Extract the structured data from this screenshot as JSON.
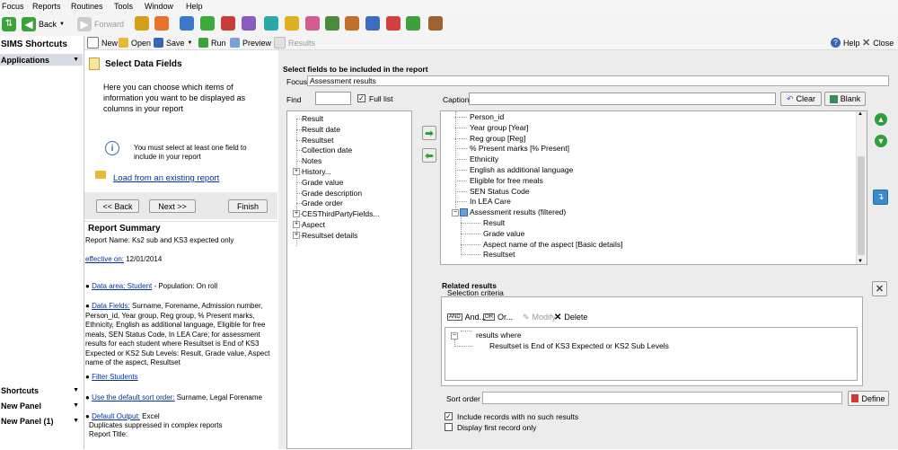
{
  "menu": [
    "Focus",
    "Reports",
    "Routines",
    "Tools",
    "Window",
    "Help"
  ],
  "toolbar": {
    "back": "Back",
    "forward": "Forward"
  },
  "sidebar": {
    "title": "SIMS Shortcuts",
    "applications": "Applications",
    "shortcuts": "Shortcuts",
    "new_panel": "New Panel",
    "new_panel_1": "New Panel (1)"
  },
  "report_toolbar": {
    "new": "New",
    "open": "Open",
    "save": "Save",
    "run": "Run",
    "preview": "Preview",
    "results": "Results",
    "help": "Help",
    "close": "Close"
  },
  "wizard": {
    "title": "Select Data Fields",
    "description": "Here you can choose which items of information you want to be displayed as columns in your report",
    "info": "You must select at least one field to include in your report",
    "load_link": "Load from an existing report",
    "back": "<< Back",
    "next": "Next >>",
    "finish": "Finish"
  },
  "summary": {
    "title": "Report Summary",
    "report_name": "Report Name:  Ks2 sub and KS3 expected only",
    "effective_link": "effective on:",
    "effective_date": " 12/01/2014",
    "data_area_link": "Data area: Student",
    "data_area_text": " - Population: On roll",
    "data_fields_link": "Data Fields:",
    "data_fields_text": " Surname, Forename, Admission number, Person_id, Year group, Reg group, % Present marks, Ethnicity, English as additional language, Eligible for free meals, SEN Status Code, In LEA Care; for assessment results for each student where Resultset is End of KS3 Expected or KS2 Sub Levels: Result, Grade value, Aspect name of the aspect, Resultset",
    "filter_link": "Filter Students",
    "sort_link": "Use the default sort order:",
    "sort_text": " Surname, Legal Forename",
    "output_link": "Default Output:",
    "output_text": " Excel",
    "duplicates": "Duplicates suppressed in complex reports",
    "report_title": "Report Title:"
  },
  "fields": {
    "heading": "Select fields to be included in the report",
    "focus_label": "Focus",
    "focus_value": "Assessment results",
    "find_label": "Find",
    "find_value": "",
    "full_list": "Full list",
    "caption_label": "Caption",
    "caption_value": "",
    "clear": "Clear",
    "blank": "Blank"
  },
  "available_fields": [
    {
      "label": "Result",
      "expand": false
    },
    {
      "label": "Result date",
      "expand": false
    },
    {
      "label": "Resultset",
      "expand": false
    },
    {
      "label": "Collection date",
      "expand": false
    },
    {
      "label": "Notes",
      "expand": false
    },
    {
      "label": "History...",
      "expand": true
    },
    {
      "label": "Grade value",
      "expand": false
    },
    {
      "label": "Grade description",
      "expand": false
    },
    {
      "label": "Grade order",
      "expand": false
    },
    {
      "label": "CESThirdPartyFields...",
      "expand": true
    },
    {
      "label": "Aspect",
      "expand": true
    },
    {
      "label": "Resultset details",
      "expand": true
    }
  ],
  "selected_fields": [
    {
      "label": "Person_id",
      "level": 0
    },
    {
      "label": "Year group [Year]",
      "level": 0
    },
    {
      "label": "Reg group [Reg]",
      "level": 0
    },
    {
      "label": "% Present marks [% Present]",
      "level": 0
    },
    {
      "label": "Ethnicity",
      "level": 0
    },
    {
      "label": "English as additional language",
      "level": 0
    },
    {
      "label": "Eligible for free meals",
      "level": 0
    },
    {
      "label": "SEN Status Code",
      "level": 0
    },
    {
      "label": "In LEA Care",
      "level": 0
    },
    {
      "label": "Assessment results (filtered)",
      "level": -1
    },
    {
      "label": "Result",
      "level": 1
    },
    {
      "label": "Grade value",
      "level": 1
    },
    {
      "label": "Aspect name of the aspect [Basic details]",
      "level": 1
    },
    {
      "label": "Resultset",
      "level": 1
    }
  ],
  "related": {
    "title": "Related results",
    "criteria_label": "Selection criteria",
    "and": "And...",
    "or": "Or...",
    "modify": "Modify",
    "delete": "Delete",
    "results_where": "results where",
    "condition": "Resultset is End of KS3 Expected or KS2 Sub Levels",
    "sort_label": "Sort order",
    "sort_value": "",
    "define": "Define",
    "include_no_results": "Include records with no such results",
    "display_first": "Display first record only"
  },
  "icon_colors": [
    "#d4a017",
    "#e8732c",
    "#3a78c9",
    "#3caa3c",
    "#c83c3c",
    "#8a5cc2",
    "#2aa7a7",
    "#e0b020",
    "#d05c90",
    "#4a8c3c",
    "#c0702a",
    "#3c6cc0",
    "#d04040",
    "#40a040",
    "#a06030"
  ]
}
